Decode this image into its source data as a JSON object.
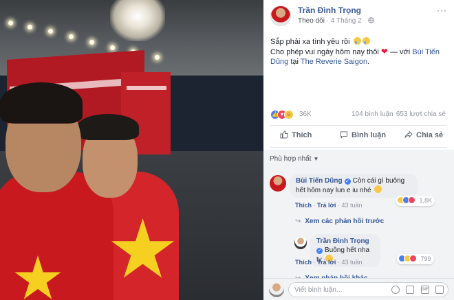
{
  "post": {
    "author": "Trần Đình Trọng",
    "follow": "Theo dõi",
    "date": "4 Tháng 2",
    "privacy_icon": "globe-icon",
    "more": "···",
    "line1": "Sắp phải xa tình yêu rồi",
    "line2": "Cho phép vui ngày hôm nay thôi",
    "with_text": "— với",
    "tagged": "Bùi Tiến Dũng",
    "at_text": "tại",
    "place": "The Reverie Saigon",
    "period": "."
  },
  "stats": {
    "reactions": "36K",
    "comments": "104 bình luận",
    "shares": "653 lượt chia sẻ"
  },
  "actions": {
    "like": "Thích",
    "comment": "Bình luận",
    "share": "Chia sẻ"
  },
  "sort": {
    "label": "Phù hợp nhất"
  },
  "comments": [
    {
      "name": "Bùi Tiến Dũng",
      "text": "Còn cái gì buông hết hôm nay lun e iu nhé",
      "like": "Thích",
      "reply": "Trả lời",
      "time": "43 tuần",
      "reaction_count": "1,8K"
    },
    {
      "name": "Trần Đình Trọng",
      "text": "Buông hết nha ty",
      "like": "Thích",
      "reply": "Trả lời",
      "time": "43 tuần",
      "reaction_count": "799"
    }
  ],
  "view_previous": "Xem các phản hồi trước",
  "view_more": "Xem phản hồi khác",
  "compose": {
    "placeholder": "Viết bình luận..."
  },
  "colors": {
    "link": "#365899",
    "accent": "#4d7ded",
    "love": "#f0445c"
  }
}
